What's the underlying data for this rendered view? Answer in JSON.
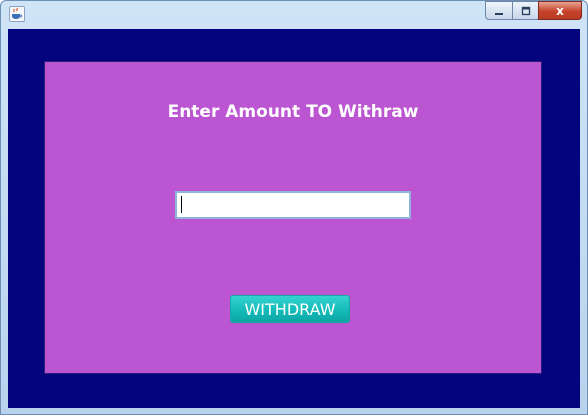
{
  "window": {
    "title": "",
    "app_icon": "java-coffee-cup-icon",
    "controls": {
      "minimize": "minimize-icon",
      "maximize": "maximize-icon",
      "close": "close-icon",
      "close_glyph": "x"
    }
  },
  "form": {
    "heading": "Enter Amount TO Withraw",
    "amount_value": "",
    "withdraw_label": "WITHDRAW"
  },
  "colors": {
    "frame_background": "#04047f",
    "panel_background": "#bb55d2",
    "button_accent": "#12b9b7",
    "heading_text": "#ffffff"
  }
}
